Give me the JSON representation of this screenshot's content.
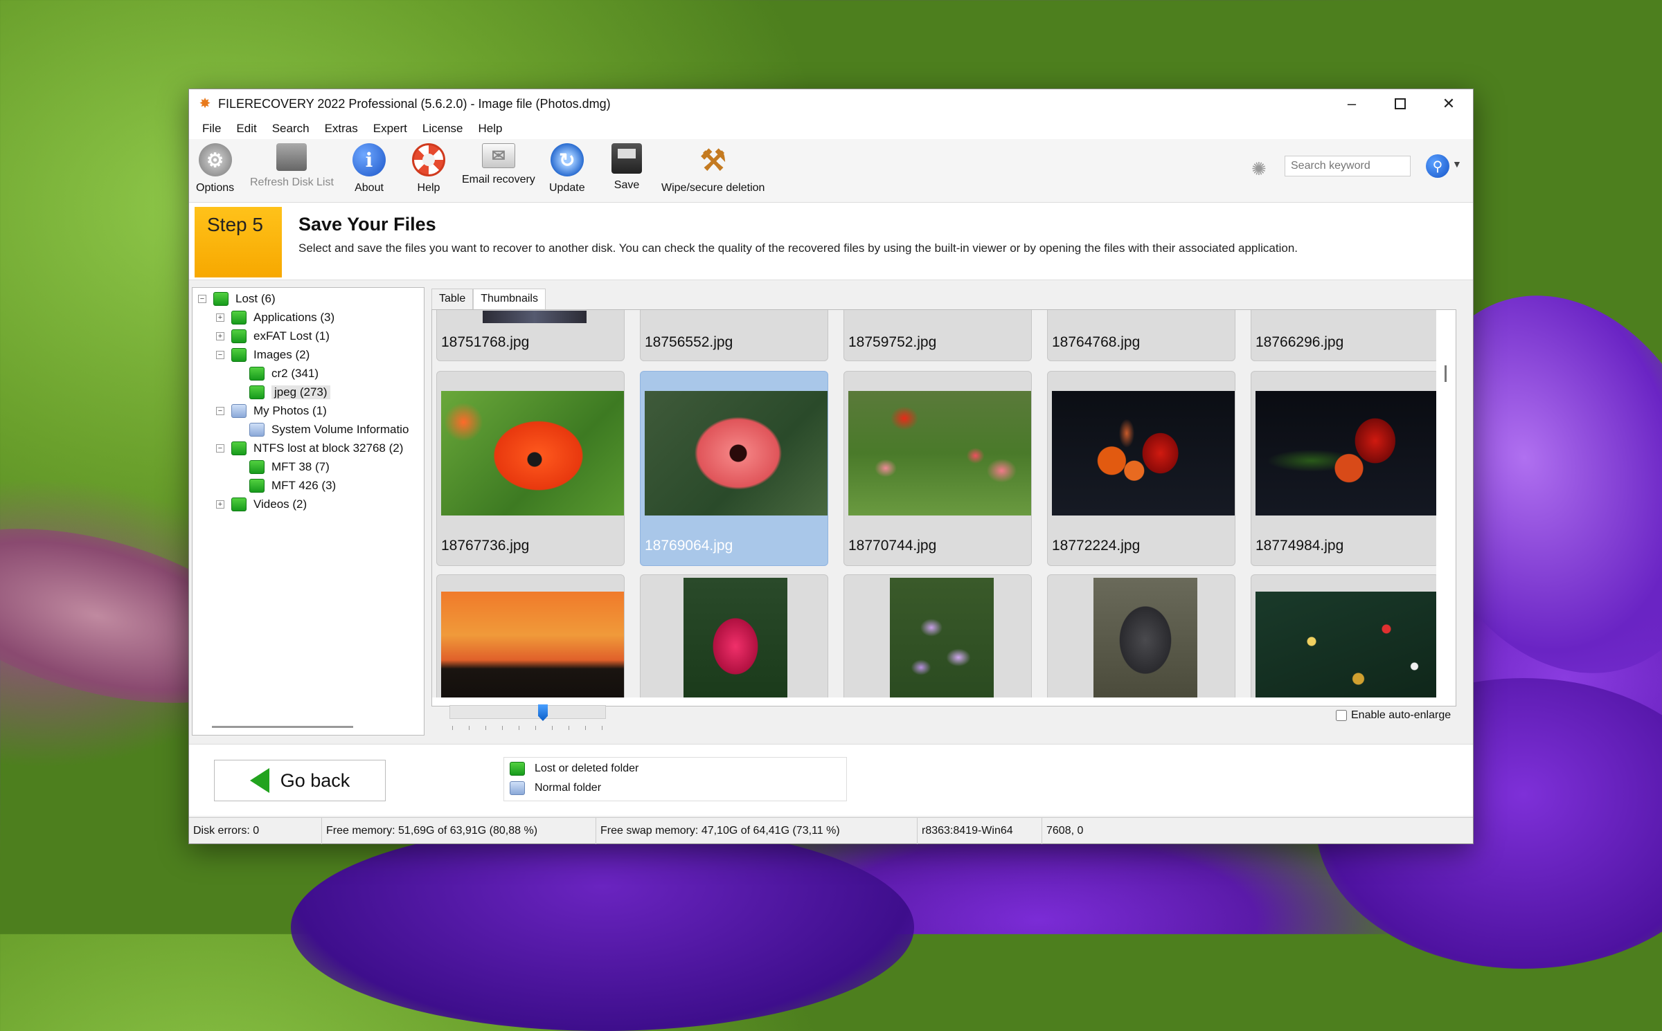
{
  "window": {
    "title": "FILERECOVERY 2022 Professional (5.6.2.0) - Image file (Photos.dmg)",
    "app_icon": "filerecovery-star-icon"
  },
  "menu": [
    "File",
    "Edit",
    "Search",
    "Extras",
    "Expert",
    "License",
    "Help"
  ],
  "toolbar": {
    "options": "Options",
    "refresh": "Refresh Disk List",
    "about": "About",
    "help": "Help",
    "email": "Email recovery",
    "update": "Update",
    "save": "Save",
    "wipe": "Wipe/secure deletion",
    "search_placeholder": "Search keyword"
  },
  "step": {
    "badge": "Step 5",
    "title": "Save Your Files",
    "description": "Select and save the files you want to recover to another disk. You can check the quality of the recovered files by using the built-in viewer or by opening the files with their associated application."
  },
  "tree": [
    {
      "label": "Lost (6)",
      "type": "lost",
      "expander": "−"
    },
    {
      "label": "Applications (3)",
      "type": "lost",
      "expander": "+"
    },
    {
      "label": "exFAT Lost (1)",
      "type": "lost",
      "expander": "+"
    },
    {
      "label": "Images (2)",
      "type": "lost",
      "expander": "−"
    },
    {
      "label": "cr2 (341)",
      "type": "lost",
      "expander": ""
    },
    {
      "label": "jpeg (273)",
      "type": "lost",
      "expander": "",
      "selected": true
    },
    {
      "label": "My Photos (1)",
      "type": "normal",
      "expander": "−"
    },
    {
      "label": "System Volume Informatio",
      "type": "normal",
      "expander": ""
    },
    {
      "label": "NTFS lost at block 32768 (2)",
      "type": "lost",
      "expander": "−"
    },
    {
      "label": "MFT 38 (7)",
      "type": "lost",
      "expander": ""
    },
    {
      "label": "MFT 426 (3)",
      "type": "lost",
      "expander": ""
    },
    {
      "label": "Videos (2)",
      "type": "lost",
      "expander": "+"
    }
  ],
  "tabs": {
    "table": "Table",
    "thumbnails": "Thumbnails"
  },
  "thumbnails": {
    "row1": [
      "18751768.jpg",
      "18756552.jpg",
      "18759752.jpg",
      "18764768.jpg",
      "18766296.jpg"
    ],
    "row2": [
      "18767736.jpg",
      "18769064.jpg",
      "18770744.jpg",
      "18772224.jpg",
      "18774984.jpg"
    ],
    "selected": "18769064.jpg"
  },
  "zoom_level": 0.6,
  "auto_enlarge": {
    "label": "Enable auto-enlarge",
    "checked": false
  },
  "bottom": {
    "go_back": "Go back",
    "legend_lost": "Lost or deleted folder",
    "legend_normal": "Normal folder"
  },
  "status": {
    "disk_errors": "Disk errors: 0",
    "free_memory": "Free memory: 51,69G of 63,91G (80,88 %)",
    "free_swap": "Free swap memory: 47,10G of 64,41G (73,11 %)",
    "build": "r8363:8419-Win64",
    "coords": "7608, 0"
  },
  "colors": {
    "accent": "#f7a800",
    "selection": "#a9c7e9",
    "lost_folder": "#22a31e",
    "normal_folder": "#8aa8d8"
  }
}
